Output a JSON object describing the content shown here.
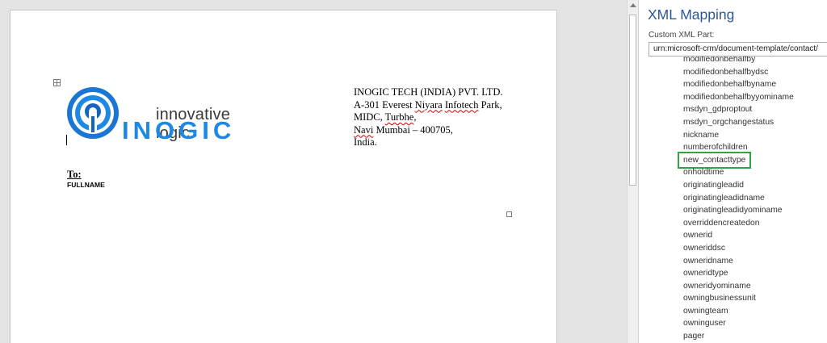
{
  "document": {
    "logo": {
      "tagline": "innovative logic",
      "wordmark": "INOGIC"
    },
    "address": {
      "line1": "INOGIC TECH (INDIA) PVT. LTD.",
      "line2_pre": "A-301 Everest ",
      "line2_sq1": "Niyara",
      "line2_mid": " ",
      "line2_sq2": "Infotech",
      "line2_post": " Park,",
      "line3_pre": "MIDC, ",
      "line3_sq": "Turbhe",
      "line3_post": ",",
      "line4_sq": "Navi",
      "line4_post": " Mumbai – 400705,",
      "line5": "India."
    },
    "to_label": "To:",
    "fullname": "FULLNAME"
  },
  "pane": {
    "title": "XML Mapping",
    "custom_part_label": "Custom XML Part:",
    "custom_part_value": "urn:microsoft-crm/document-template/contact/",
    "items": [
      "modifiedonbehalfby",
      "modifiedonbehalfbydsc",
      "modifiedonbehalfbyname",
      "modifiedonbehalfbyyominame",
      "msdyn_gdproptout",
      "msdyn_orgchangestatus",
      "nickname",
      "numberofchildren",
      "new_contacttype",
      "onholdtime",
      "originatingleadid",
      "originatingleadidname",
      "originatingleadidyominame",
      "overriddencreatedon",
      "ownerid",
      "owneriddsc",
      "owneridname",
      "owneridtype",
      "owneridyominame",
      "owningbusinessunit",
      "owningteam",
      "owninguser",
      "pager"
    ],
    "selected_index": 8,
    "selected_color": "#2fa642"
  },
  "colors": {
    "accent": "#2b579a",
    "logo_blue": "#1e88e5"
  }
}
